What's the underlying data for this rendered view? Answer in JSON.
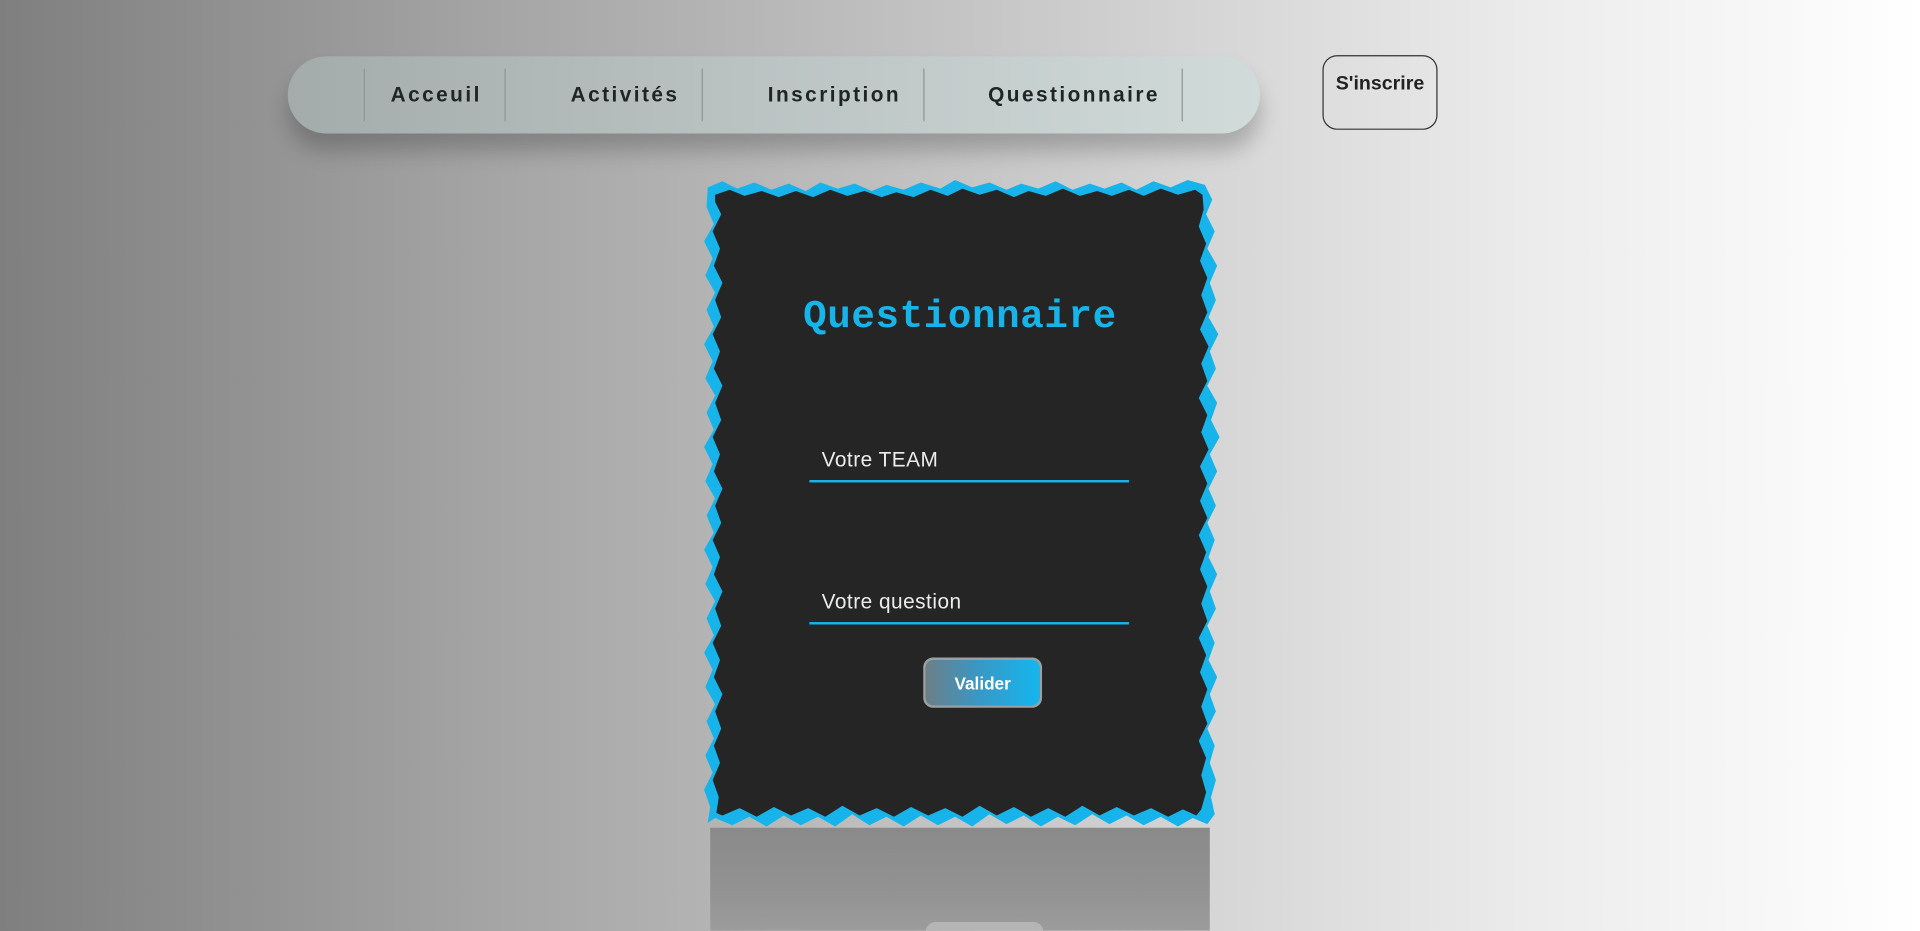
{
  "nav": {
    "items": [
      {
        "label": "Acceuil"
      },
      {
        "label": "Activités"
      },
      {
        "label": "Inscription"
      },
      {
        "label": "Questionnaire"
      }
    ]
  },
  "signup_label": "S'inscrire",
  "form": {
    "title": "Questionnaire",
    "team_placeholder": "Votre TEAM",
    "question_placeholder": "Votre question",
    "submit_label": "Valider"
  },
  "colors": {
    "accent": "#16b4ea",
    "card_background": "#252525"
  }
}
